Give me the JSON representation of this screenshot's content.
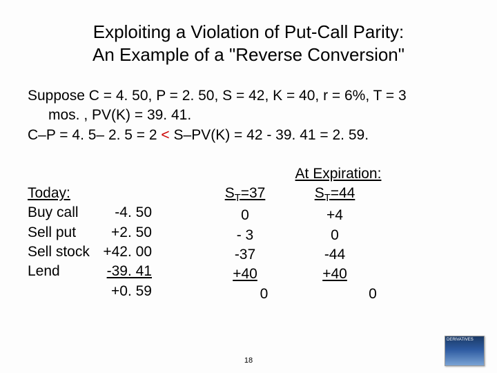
{
  "title_line1": "Exploiting a Violation of Put-Call Parity:",
  "title_line2": "An Example of a \"Reverse Conversion\"",
  "given_prefix": "Suppose C = 4. 50, P = 2. 50, S = 42, K = 40, r = 6%, T = 3",
  "given_cont": "mos. , PV(K) = 39. 41.",
  "relation_a": "C–P = 4. 5– 2. 5 = 2 ",
  "relation_lt": "<",
  "relation_b": " S–PV(K) = 42 - 39. 41 = 2. 59.",
  "today": {
    "header": "Today:",
    "rows": [
      {
        "label": "Buy call",
        "value": "-4. 50"
      },
      {
        "label": "Sell put",
        "value": "+2. 50"
      },
      {
        "label": "Sell stock",
        "value": "+42. 00"
      },
      {
        "label": "Lend",
        "value": "-39. 41"
      }
    ],
    "total": "+0. 59"
  },
  "expiration": {
    "header": "At Expiration:",
    "col1_head_pre": "S",
    "col1_head_sub": "T",
    "col1_head_post": "=37",
    "col2_head_pre": "S",
    "col2_head_sub": "T",
    "col2_head_post": "=44",
    "rows": [
      {
        "c1": "0",
        "c2": "+4"
      },
      {
        "c1": "- 3",
        "c2": "0"
      },
      {
        "c1": "-37",
        "c2": "-44"
      },
      {
        "c1": "+40",
        "c2": "+40"
      }
    ],
    "tot1": "0",
    "tot2": "0"
  },
  "page_number": "18",
  "thumb_label": "DERIVATIVES"
}
